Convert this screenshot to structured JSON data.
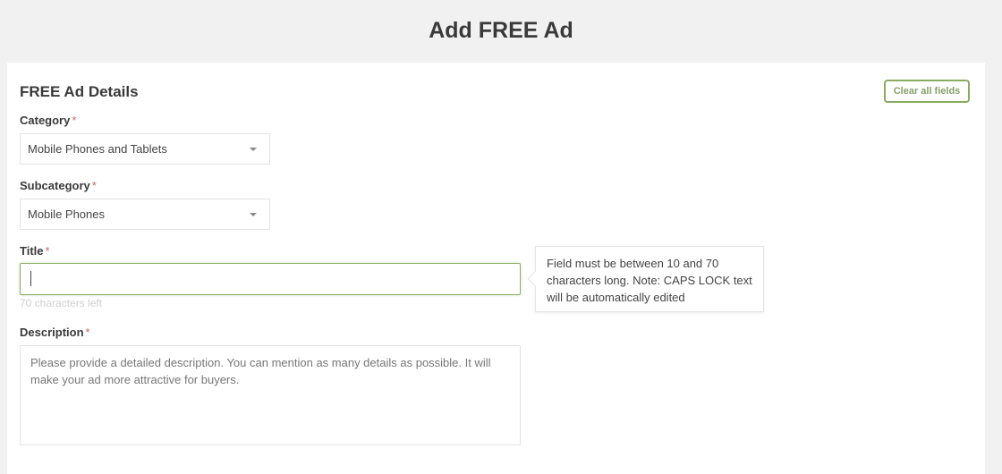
{
  "header": {
    "title": "Add FREE Ad"
  },
  "form": {
    "section_title": "FREE Ad Details",
    "clear_button": "Clear all fields",
    "required_mark": "*",
    "category": {
      "label": "Category",
      "value": "Mobile Phones and Tablets"
    },
    "subcategory": {
      "label": "Subcategory",
      "value": "Mobile Phones"
    },
    "title": {
      "label": "Title",
      "value": "",
      "chars_left": "70 characters left",
      "tooltip": "Field must be between 10 and 70 characters long. Note: CAPS LOCK text will be automatically edited"
    },
    "description": {
      "label": "Description",
      "value": "",
      "placeholder": "Please provide a detailed description. You can mention as many details as possible. It will make your ad more attractive for buyers."
    }
  },
  "colors": {
    "accent": "#8aac62",
    "background": "#f1f1f1",
    "required": "#c56a6a"
  }
}
